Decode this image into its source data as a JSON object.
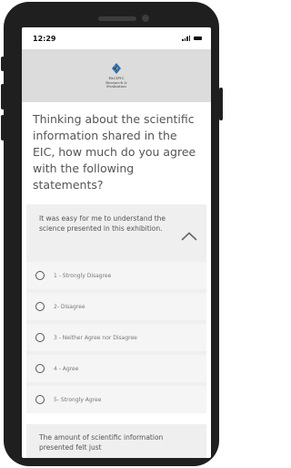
{
  "status": {
    "time": "12:29"
  },
  "header": {
    "logo_line1": "PACIFIC",
    "logo_line2": "Research &",
    "logo_line3": "Evaluation"
  },
  "question": "Thinking about the scientific information shared in the EIC, how much do you agree with the following statements?",
  "statement1": "It was easy for me to understand the science presented in this exhibition.",
  "options": [
    {
      "label": "1 - Strongly Disagree"
    },
    {
      "label": "2- Disagree"
    },
    {
      "label": "3 - Neither Agree nor Disagree"
    },
    {
      "label": "4 - Agree"
    },
    {
      "label": "5- Strongly Agree"
    }
  ],
  "statement2": "The amount of scientific information presented felt just",
  "colors": {
    "header_bg": "#dcdcdc",
    "card_bg": "#efefef",
    "logo_blue": "#2a6fb5"
  }
}
